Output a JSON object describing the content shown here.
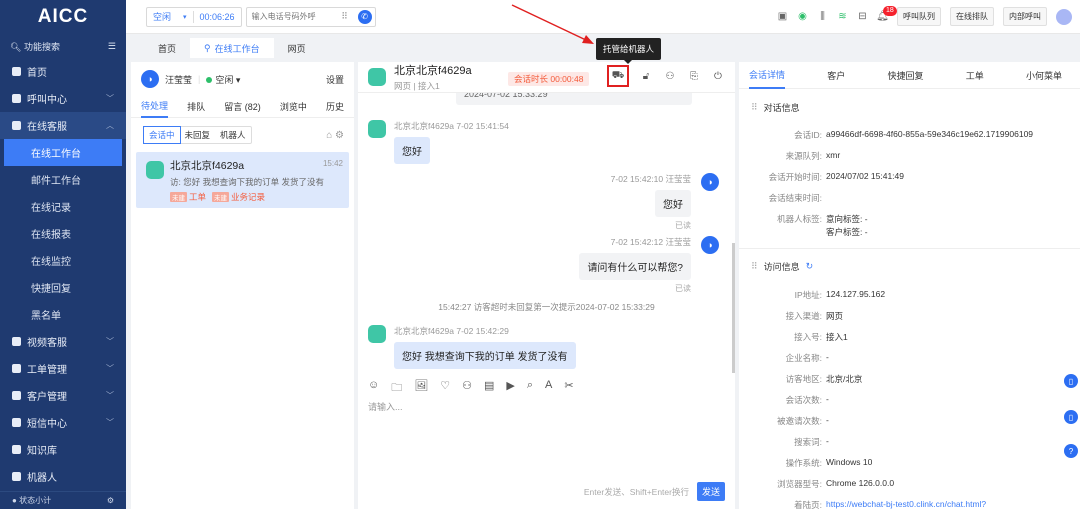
{
  "app": {
    "logo": "AICC"
  },
  "sidebar": {
    "search": "功能搜索",
    "items": [
      {
        "label": "首页",
        "open": false,
        "chevron": false
      },
      {
        "label": "呼叫中心",
        "chevron": true
      },
      {
        "label": "在线客服",
        "chevron": true,
        "open": true
      }
    ],
    "subs": [
      "在线工作台",
      "邮件工作台",
      "在线记录",
      "在线报表",
      "在线监控",
      "快捷回复",
      "黑名单"
    ],
    "items2": [
      {
        "label": "视频客服",
        "chevron": true
      },
      {
        "label": "工单管理",
        "chevron": true
      },
      {
        "label": "客户管理",
        "chevron": true
      },
      {
        "label": "短信中心",
        "chevron": true
      },
      {
        "label": "知识库",
        "chevron": false
      },
      {
        "label": "机器人",
        "chevron": false
      }
    ],
    "footer": "状态小计"
  },
  "topbar": {
    "status": "空闲",
    "timer": "00:06:26",
    "phone_placeholder": "输入电话号码外呼",
    "badge": "18",
    "buttons": [
      "呼叫队列",
      "在线排队",
      "内部呼叫"
    ]
  },
  "tabs": [
    "首页",
    "在线工作台",
    "网页"
  ],
  "left": {
    "agent": "汪莹莹",
    "status": "空闲",
    "settings": "设置",
    "tabs": [
      "待处理",
      "排队",
      "留言 (82)",
      "浏览中",
      "历史"
    ],
    "filters": [
      "会话中",
      "未回复",
      "机器人"
    ],
    "session": {
      "name": "北京北京f4629a",
      "time": "15:42",
      "preview": "访: 您好 我想查询下我的订单 发货了没有",
      "tags": [
        {
          "mark": "未建",
          "label": "工单"
        },
        {
          "mark": "未建",
          "label": "业务记录"
        }
      ]
    }
  },
  "chat": {
    "name": "北京北京f4629a",
    "sub1": "网页",
    "sub2": "接入1",
    "duration": "会话时长 00:00:48",
    "tooltip": "托管给机器人",
    "cut_text": "2024-07-02 15:33:29",
    "m1": {
      "head": "北京北京f4629a  7-02 15:41:54",
      "text": "您好"
    },
    "m2": {
      "head": "7-02 15:42:10 汪莹莹",
      "text": "您好",
      "read": "已读"
    },
    "m3": {
      "head": "7-02 15:42:12 汪莹莹",
      "text": "请问有什么可以帮您?",
      "read": "已读"
    },
    "sys": "15:42:27 访客超时未回复第一次提示2024-07-02 15:33:29",
    "m4": {
      "head": "北京北京f4629a  7-02 15:42:29",
      "text": "您好 我想查询下我的订单 发货了没有"
    },
    "input_placeholder": "请输入...",
    "send_hint": "Enter发送、Shift+Enter换行",
    "send": "发送"
  },
  "right": {
    "tabs": [
      "会话详情",
      "客户",
      "快捷回复",
      "工单",
      "小何菜单"
    ],
    "sec1": "对话信息",
    "conv": [
      {
        "k": "会话ID:",
        "v": "a99466df-6698-4f60-855a-59e346c19e62.1719906109"
      },
      {
        "k": "来源队列:",
        "v": "xmr"
      },
      {
        "k": "会话开始时间:",
        "v": "2024/07/02 15:41:49"
      },
      {
        "k": "会话结束时间:",
        "v": ""
      },
      {
        "k": "机器人标签:",
        "v": "意向标签: -"
      },
      {
        "k": "",
        "v": "客户标签: -"
      }
    ],
    "sec2": "访问信息",
    "visit": [
      {
        "k": "IP地址:",
        "v": "124.127.95.162"
      },
      {
        "k": "接入渠道:",
        "v": "网页"
      },
      {
        "k": "接入号:",
        "v": "接入1"
      },
      {
        "k": "企业名称:",
        "v": "-"
      },
      {
        "k": "访客地区:",
        "v": "北京/北京"
      },
      {
        "k": "会话次数:",
        "v": "-"
      },
      {
        "k": "被邀请次数:",
        "v": "-"
      },
      {
        "k": "搜索词:",
        "v": "-"
      },
      {
        "k": "操作系统:",
        "v": "Windows 10"
      },
      {
        "k": "浏览器型号:",
        "v": "Chrome 126.0.0.0"
      },
      {
        "k": "着陆页:",
        "v": "https://webchat-bj-test0.clink.cn/chat.html?"
      }
    ]
  },
  "colors": {
    "sidebar": "#1f3a70",
    "accent": "#3d7cf6",
    "highlight": "#e02020"
  }
}
